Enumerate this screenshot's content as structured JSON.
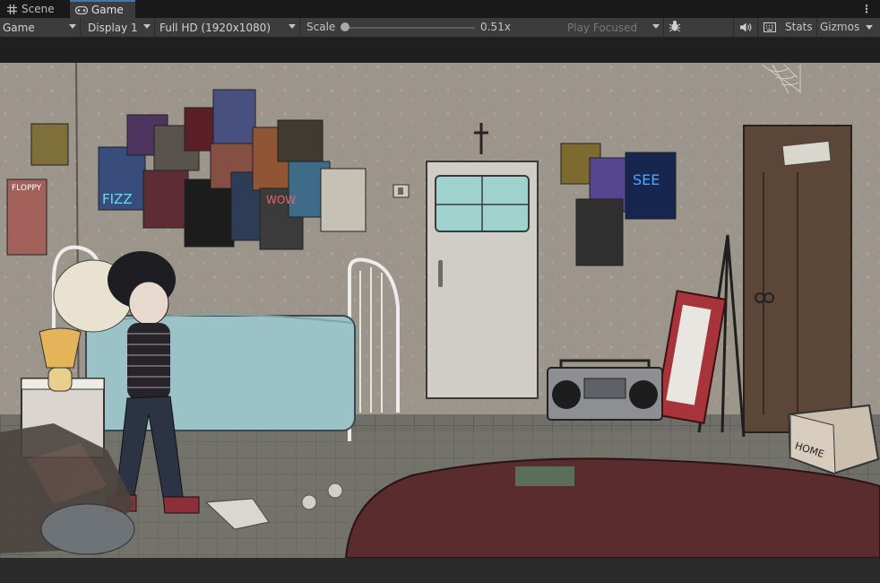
{
  "tabs": [
    {
      "label": "Scene",
      "icon": "grid-icon"
    },
    {
      "label": "Game",
      "icon": "gamepad-icon"
    }
  ],
  "toolbar": {
    "game_view": "Game",
    "display": "Display 1",
    "resolution": "Full HD (1920x1080)",
    "scale_label": "Scale",
    "scale_value": "0.51x",
    "scale_level": 0.0,
    "play_mode": "Play Focused",
    "stats_label": "Stats",
    "gizmos_label": "Gizmos"
  },
  "scene": {
    "poster_texts": [
      "FLOPPY",
      "FIZZ",
      "WOW",
      "SEE",
      "HOME"
    ],
    "box_label": "HOME"
  },
  "colors": {
    "tab_active_accent": "#3a79bb",
    "toolbar_bg": "#3c3c3c",
    "wall": "#9c958c",
    "floor": "#6e6d67"
  }
}
